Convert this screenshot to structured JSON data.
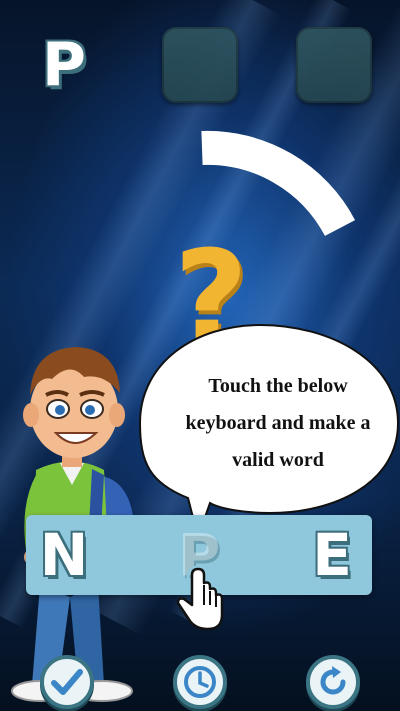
{
  "slots": [
    {
      "letter": "P",
      "filled": true
    },
    {
      "letter": "",
      "filled": false
    },
    {
      "letter": "",
      "filled": false
    }
  ],
  "question_mark": "?",
  "tutorial": {
    "line1": "Touch the below",
    "line2": "keyboard and make a",
    "line3": "valid word"
  },
  "keyboard": {
    "keys": [
      "N",
      "P",
      "E"
    ]
  },
  "buttons": {
    "check": "check-icon",
    "hint": "clock-icon",
    "restart": "refresh-icon"
  },
  "colors": {
    "accent_yellow": "#f2b531",
    "tile_blue": "#8fc8dc",
    "tile_shadow": "#3d6e7c",
    "button_ring": "#3b7483"
  }
}
